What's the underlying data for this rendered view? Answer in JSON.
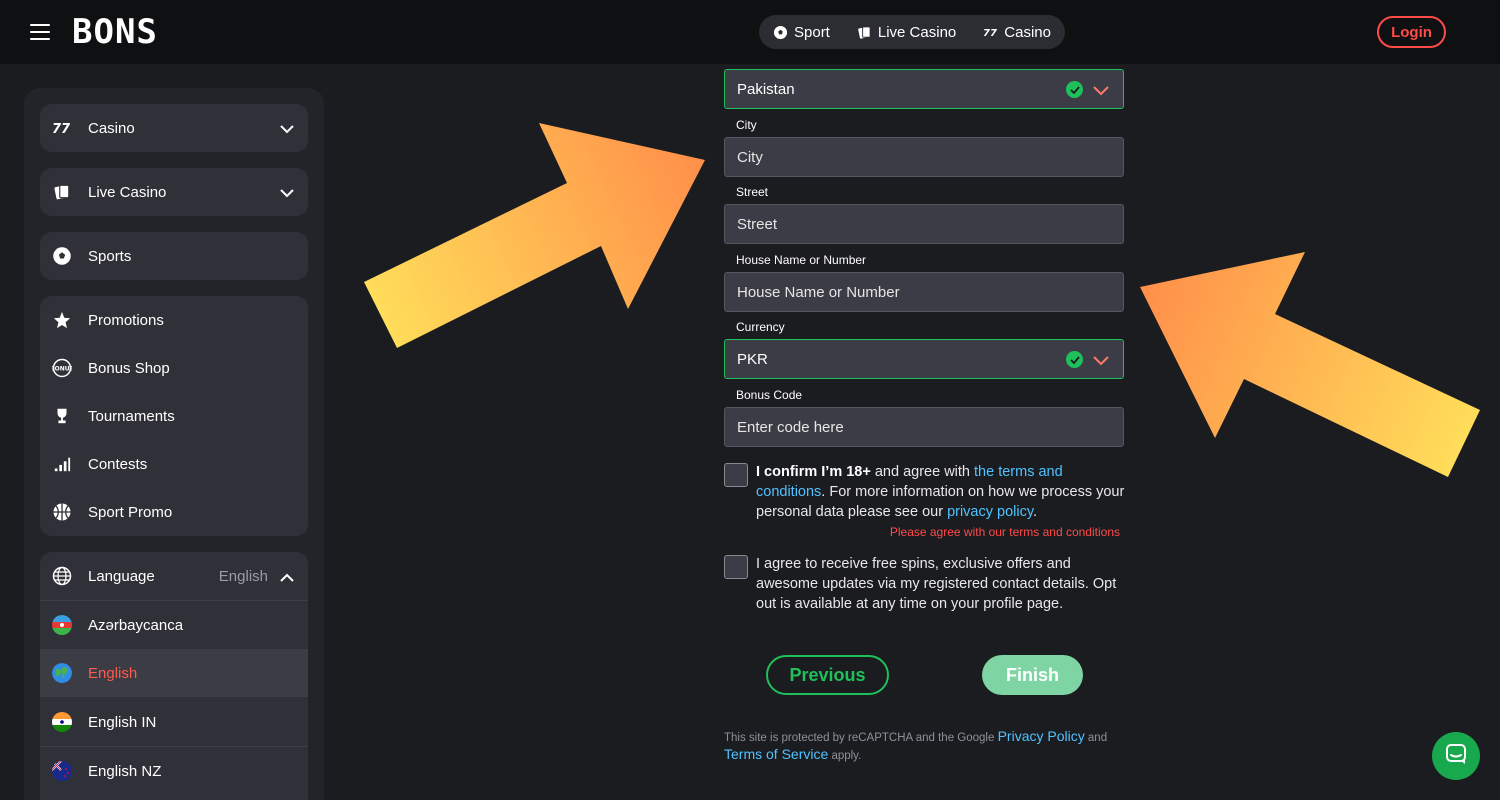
{
  "header": {
    "logo_text": "BONS",
    "nav": [
      {
        "label": "Sport",
        "icon": "soccer-ball-icon"
      },
      {
        "label": "Live Casino",
        "icon": "cards-icon"
      },
      {
        "label": "Casino",
        "icon": "sevens-icon"
      }
    ],
    "login_label": "Login"
  },
  "sidebar": {
    "casino": "Casino",
    "live_casino": "Live Casino",
    "sports": "Sports",
    "menu": [
      {
        "label": "Promotions",
        "icon": "star-icon"
      },
      {
        "label": "Bonus Shop",
        "icon": "bonus-icon"
      },
      {
        "label": "Tournaments",
        "icon": "trophy-icon"
      },
      {
        "label": "Contests",
        "icon": "bars-icon"
      },
      {
        "label": "Sport Promo",
        "icon": "basketball-icon"
      }
    ],
    "language": {
      "label": "Language",
      "current": "English",
      "options": [
        "Azərbaycanca",
        "English",
        "English IN",
        "English NZ"
      ]
    }
  },
  "form": {
    "country_value": "Pakistan",
    "city_label": "City",
    "city_placeholder": "City",
    "street_label": "Street",
    "street_placeholder": "Street",
    "house_label": "House Name or Number",
    "house_placeholder": "House Name or Number",
    "currency_label": "Currency",
    "currency_value": "PKR",
    "bonus_label": "Bonus Code",
    "bonus_placeholder": "Enter code here",
    "terms": {
      "bold": "I confirm I’m 18+",
      "text1": " and agree with ",
      "terms_link": "the terms and conditions",
      "text2": ". For more information on how we process your personal data please see our ",
      "privacy_link": "privacy policy",
      "text3": "."
    },
    "terms_error": "Please agree with our terms and conditions",
    "offers_text": "I agree to receive free spins, exclusive offers and awesome updates via my registered contact details. Opt out is available at any time on your profile page.",
    "previous_label": "Previous",
    "finish_label": "Finish",
    "recaptcha": {
      "text1": "This site is protected by reCAPTCHA and the Google ",
      "privacy_link": "Privacy Policy",
      "text2": " and ",
      "terms_link": "Terms of Service",
      "text3": " apply."
    }
  },
  "colors": {
    "accent_red": "#ff4a4a",
    "success_green": "#1fbf5a",
    "link_blue": "#4fc3ff",
    "arrow_orange": "#ff8f4a",
    "arrow_yellow": "#ffe05a"
  }
}
